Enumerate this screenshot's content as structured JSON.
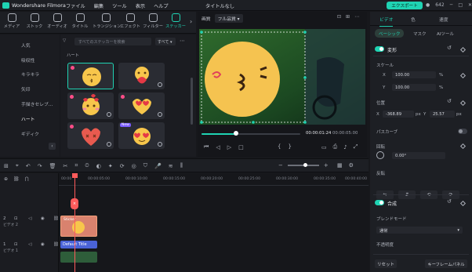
{
  "app": {
    "name": "Wondershare Filmora",
    "project_title": "タイトルなし",
    "export_label": "エクスポート",
    "counter": "642"
  },
  "menu": [
    "ファイル",
    "編集",
    "ツール",
    "表示",
    "ヘルプ"
  ],
  "asset_tabs": [
    {
      "label": "メディア",
      "icon": "media-icon"
    },
    {
      "label": "ストック",
      "icon": "stock-icon"
    },
    {
      "label": "オーディオ",
      "icon": "audio-icon"
    },
    {
      "label": "タイトル",
      "icon": "title-icon"
    },
    {
      "label": "トランジション",
      "icon": "transition-icon"
    },
    {
      "label": "エフェクト",
      "icon": "effect-icon"
    },
    {
      "label": "フィルター",
      "icon": "filter-icon"
    },
    {
      "label": "ステッカー",
      "icon": "sticker-icon",
      "active": true
    }
  ],
  "categories": [
    "人気",
    "吸収性",
    "キラキラ",
    "矢印",
    "手描きセレブ...",
    "ハート",
    "ギディク"
  ],
  "active_category": "ハート",
  "sticker_panel": {
    "filter_label": "▽",
    "search_placeholder": "すべてのステッカーを検索",
    "sort_value": "すべて",
    "section_title": "ハート",
    "tiles": [
      {
        "name": "kiss-face-heart",
        "selected": true,
        "pin": true
      },
      {
        "name": "heart-hug",
        "selected": false
      },
      {
        "name": "face-heart-blush",
        "selected": false,
        "pin": true
      },
      {
        "name": "heart-eyes-sunglasses",
        "selected": false,
        "pin": true
      },
      {
        "name": "dizzy-heart",
        "selected": false,
        "pin": true
      },
      {
        "name": "heart-eyes-face",
        "selected": false,
        "new": true
      }
    ],
    "new_badge": "New"
  },
  "player": {
    "quality_label": "画質",
    "quality_value": "フル品質",
    "time_current": "00:00:01:24",
    "time_total": "00:00:05:00",
    "progress": 0.35
  },
  "properties": {
    "tabs": [
      "ビデオ",
      "色",
      "速度"
    ],
    "subtabs": [
      "ベーシック",
      "マスク",
      "AIツール"
    ],
    "transform_label": "変形",
    "scale_label": "スケール",
    "scale_x": "100.00",
    "scale_y": "100.00",
    "unit": "%",
    "position_label": "位置",
    "position_x": "-368.89",
    "position_y": "25.57",
    "position_unit": "px",
    "path_curve_label": "パスカーブ",
    "rotate_label": "回転",
    "rotate_value": "0.00°",
    "flip_label": "反転",
    "composite_label": "合成",
    "blend_mode_label": "ブレンドモード",
    "blend_mode_value": "通常",
    "opacity_label": "不透明度",
    "reset_label": "リセット",
    "keyframe_panel_label": "キーフレームパネル"
  },
  "timeline": {
    "ruler": [
      "00:00",
      "00:00:05:00",
      "00:00:10:00",
      "00:00:15:00",
      "00:00:20:00",
      "00:00:25:00",
      "00:00:30:00",
      "00:00:35:00",
      "00:00:40:00"
    ],
    "tracks": [
      {
        "index": "2",
        "name": "ビデオ 2"
      },
      {
        "index": "1",
        "name": "ビデオ 1"
      }
    ],
    "marker_label": "×",
    "sticker_clip_label": "Sticker",
    "title_clip_label": "Default Title",
    "video_clip_label": ""
  },
  "colors": {
    "accent": "#1fd3b3",
    "playhead": "#ff5b5b",
    "title_clip": "#4a63d6"
  }
}
